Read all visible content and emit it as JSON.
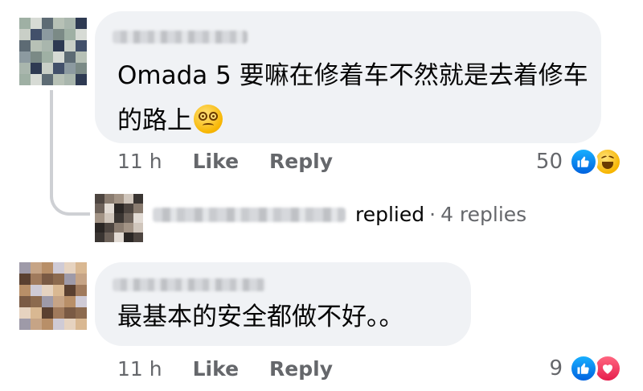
{
  "comments": [
    {
      "text": "Omada 5 要嘛在修着车不然就是去着修车的路上",
      "emoji": "dizzy-face",
      "time": "11 h",
      "like_label": "Like",
      "reply_label": "Reply",
      "reaction_count": "50",
      "reactions": [
        "like-icon",
        "haha-icon"
      ]
    },
    {
      "text": "最基本的安全都做不好。。",
      "time": "11 h",
      "like_label": "Like",
      "reply_label": "Reply",
      "reaction_count": "9",
      "reactions": [
        "like-icon",
        "love-icon"
      ]
    }
  ],
  "reply_summary": {
    "action": "replied",
    "separator": "·",
    "replies": "4 replies"
  },
  "colors": {
    "bubble": "#f0f2f5",
    "meta_text": "#65676b",
    "like_blue": "#0062df",
    "love_red": "#e61e4d",
    "thread_line": "#ced0d4"
  }
}
